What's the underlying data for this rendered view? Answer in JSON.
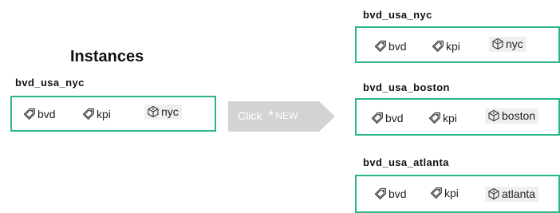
{
  "left_panel": {
    "title": "Instances",
    "instance": {
      "name": "bvd_usa_nyc",
      "tags": [
        {
          "label": "bvd",
          "icon": "tag-icon"
        },
        {
          "label": "kpi",
          "icon": "tag-icon"
        },
        {
          "label": "nyc",
          "icon": "location-cube-icon"
        }
      ]
    }
  },
  "action_arrow": {
    "click_label": "Click",
    "star_glyph": "*",
    "new_label": "NEW",
    "color": "#d3d3d3"
  },
  "right_panel": {
    "instances": [
      {
        "name": "bvd_usa_nyc",
        "tags": [
          {
            "label": "bvd",
            "icon": "tag-icon"
          },
          {
            "label": "kpi",
            "icon": "tag-icon"
          },
          {
            "label": "nyc",
            "icon": "location-cube-icon"
          }
        ]
      },
      {
        "name": "bvd_usa_boston",
        "tags": [
          {
            "label": "bvd",
            "icon": "tag-icon"
          },
          {
            "label": "kpi",
            "icon": "tag-icon"
          },
          {
            "label": "boston",
            "icon": "location-cube-icon"
          }
        ]
      },
      {
        "name": "bvd_usa_atlanta",
        "tags": [
          {
            "label": "bvd",
            "icon": "tag-icon"
          },
          {
            "label": "kpi",
            "icon": "tag-icon"
          },
          {
            "label": "atlanta",
            "icon": "location-cube-icon"
          }
        ]
      }
    ]
  },
  "colors": {
    "card_border": "#2bb58a",
    "location_chip_bg": "#efefef",
    "arrow_fill": "#d3d3d3"
  }
}
